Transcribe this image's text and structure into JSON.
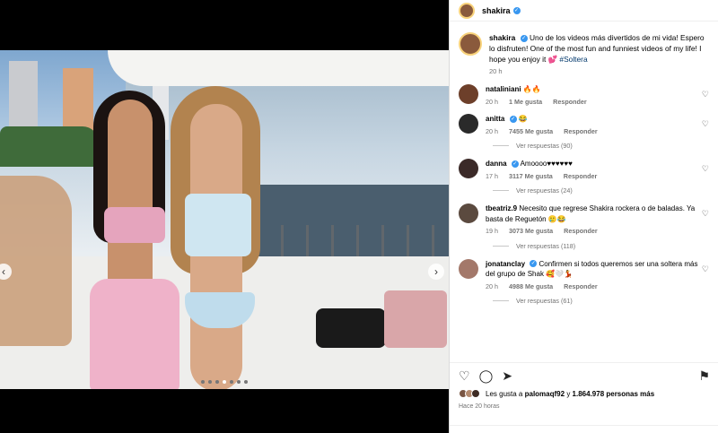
{
  "post": {
    "author": "shakira",
    "caption_main": "Uno de los videos más divertidos de mi vida! Espero lo disfruten! One of the most fun and funniest videos of my life! I hope you enjoy it",
    "caption_emoji": "💕",
    "hashtag": "#Soltera",
    "caption_time": "20 h"
  },
  "comments": [
    {
      "user": "nataliniani",
      "text": "🔥🔥",
      "time": "20 h",
      "likes": "1 Me gusta",
      "reply": "Responder",
      "verified": false,
      "replies": ""
    },
    {
      "user": "anitta",
      "text": "😂",
      "time": "20 h",
      "likes": "7455 Me gusta",
      "reply": "Responder",
      "verified": true,
      "replies": "Ver respuestas (90)"
    },
    {
      "user": "danna",
      "text": "Amoooo♥♥♥♥♥♥",
      "time": "17 h",
      "likes": "3117 Me gusta",
      "reply": "Responder",
      "verified": true,
      "replies": "Ver respuestas (24)"
    },
    {
      "user": "tbeatriz.9",
      "text": "Necesito que regrese Shakira rockera o de baladas. Ya basta de Reguetón 🥲😂",
      "time": "19 h",
      "likes": "3073 Me gusta",
      "reply": "Responder",
      "verified": false,
      "replies": "Ver respuestas (118)"
    },
    {
      "user": "jonatanclay",
      "text": "Confirmen si todos queremos ser una soltera más del grupo de Shak 🥰🤍💃",
      "time": "20 h",
      "likes": "4988 Me gusta",
      "reply": "Responder",
      "verified": true,
      "replies": "Ver respuestas (61)"
    }
  ],
  "likes": {
    "prefix": "Les gusta a",
    "user": "palomaqf92",
    "middle": "y",
    "count": "1.864.978 personas más"
  },
  "posted_ago": "Hace 20 horas",
  "icons": {
    "like": "heart-icon",
    "comment": "comment-icon",
    "share": "share-icon",
    "save": "bookmark-icon"
  },
  "carousel": {
    "slides": 7,
    "active": 3
  }
}
